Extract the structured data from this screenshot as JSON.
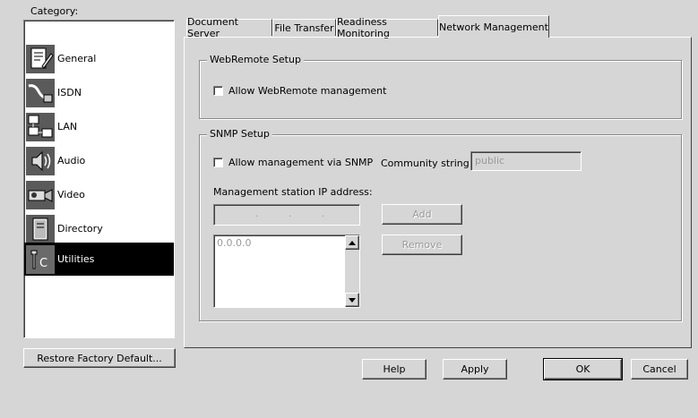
{
  "category": {
    "label": "Category:",
    "items": [
      {
        "label": "General",
        "icon": "general-icon"
      },
      {
        "label": "ISDN",
        "icon": "isdn-icon"
      },
      {
        "label": "LAN",
        "icon": "lan-icon"
      },
      {
        "label": "Audio",
        "icon": "audio-icon"
      },
      {
        "label": "Video",
        "icon": "video-icon"
      },
      {
        "label": "Directory",
        "icon": "directory-icon"
      },
      {
        "label": "Utilities",
        "icon": "utilities-icon",
        "selected": true
      }
    ],
    "restore_button": "Restore Factory Default..."
  },
  "tabs": [
    {
      "label": "Document Server"
    },
    {
      "label": "File Transfer"
    },
    {
      "label": "Readiness Monitoring"
    },
    {
      "label": "Network Management",
      "active": true
    }
  ],
  "webremote": {
    "title": "WebRemote Setup",
    "allow_label": "Allow WebRemote management",
    "allow_checked": false
  },
  "snmp": {
    "title": "SNMP Setup",
    "allow_label": "Allow management via SNMP",
    "allow_checked": false,
    "community_label": "Community string:",
    "community_value": "public",
    "station_label": "Management station IP address:",
    "ip_separators": [
      ".",
      ".",
      "."
    ],
    "add_button": "Add",
    "remove_button": "Remove",
    "station_list": [
      "0.0.0.0"
    ]
  },
  "footer": {
    "help": "Help",
    "apply": "Apply",
    "ok": "OK",
    "cancel": "Cancel"
  }
}
